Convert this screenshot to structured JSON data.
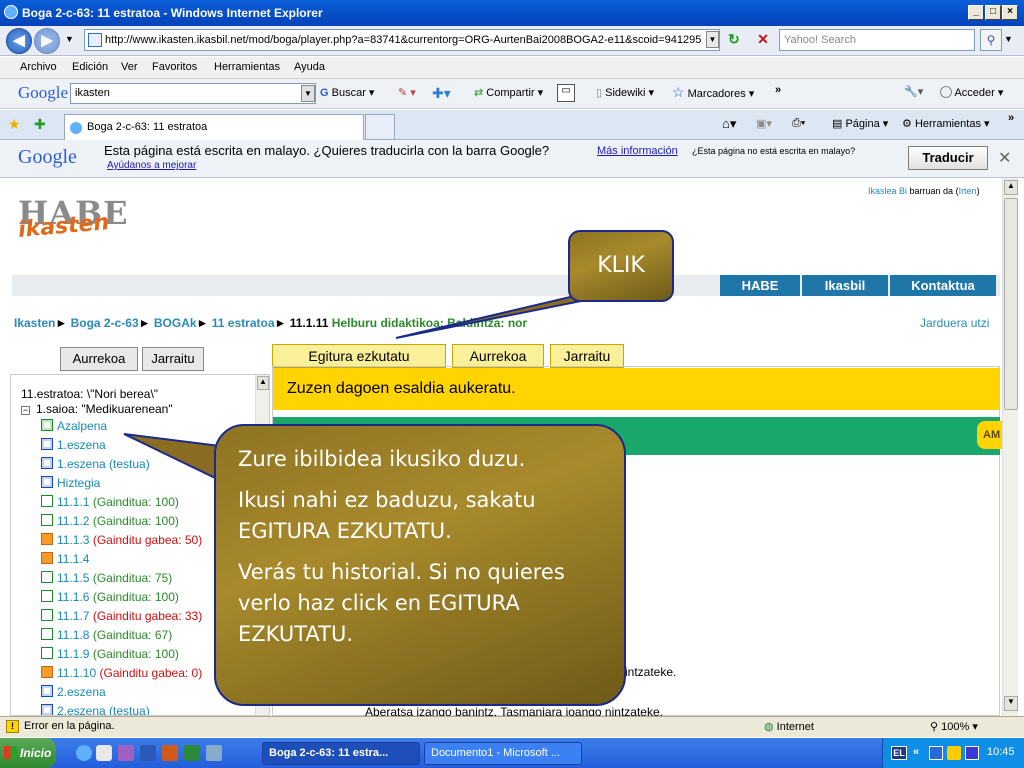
{
  "window": {
    "title": "Boga 2-c-63: 11 estratoa - Windows Internet Explorer"
  },
  "address": {
    "url": "http://www.ikasten.ikasbil.net/mod/boga/player.php?a=83741&currentorg=ORG-AurtenBai2008BOGA2-e11&scoid=941295",
    "search_placeholder": "Yahoo! Search"
  },
  "menu": [
    "Archivo",
    "Edición",
    "Ver",
    "Favoritos",
    "Herramientas",
    "Ayuda"
  ],
  "googlebar": {
    "logo": "Google",
    "query": "ikasten",
    "buscar": "Buscar",
    "compartir": "Compartir",
    "sidewiki": "Sidewiki",
    "marcadores": "Marcadores",
    "acceder": "Acceder"
  },
  "tabbar": {
    "tab_title": "Boga 2-c-63: 11 estratoa",
    "pagina": "Página",
    "herramientas": "Herramientas"
  },
  "translate": {
    "logo": "Google",
    "message": "Esta página está escrita en malayo. ¿Quieres traducirla con la barra Google?",
    "more_info": "Más información",
    "not_malay": "¿Esta página no está escrita en malayo?",
    "help": "Ayúdanos a mejorar",
    "translate_btn": "Traducir"
  },
  "site": {
    "logo_habe": "HABE",
    "logo_ikasten": "ikasten",
    "user_prefix": "Ikaslea Bi",
    "user_mid": " barruan da (",
    "user_logout": "Irten",
    "user_suffix": ")",
    "nav_tabs": [
      "HABE",
      "Ikasbil",
      "Kontaktua"
    ],
    "breadcrumb": {
      "c1": "Ikasten",
      "c2": "Boga 2-c-63",
      "c3": "BOGAk",
      "c4": "11 estratoa",
      "c5": "11.1.11",
      "c6": "Helburu didaktikoa: Baldintza: nor",
      "sep": "►"
    },
    "exit_activity": "Jarduera utzi",
    "left_buttons": [
      "Aurrekoa",
      "Jarraitu"
    ],
    "top_buttons": [
      "Egitura ezkutatu",
      "Aurrekoa",
      "Jarraitu"
    ],
    "instruction": "Zuzen dagoen esaldia aukeratu.",
    "green_tag": "AM",
    "tree_root": "11.estratoa: \\\"Nori berea\\\"",
    "tree_session": "1.saioa: \"Medikuarenean\"",
    "tree": [
      {
        "label": "Azalpena",
        "status": "",
        "status_color": "",
        "icon": "page"
      },
      {
        "label": "1.eszena",
        "status": "",
        "status_color": "",
        "icon": "page-blue"
      },
      {
        "label": "1.eszena (testua)",
        "status": "",
        "status_color": "",
        "icon": "page-blue"
      },
      {
        "label": "Hiztegia",
        "status": "",
        "status_color": "",
        "icon": "page-blue"
      },
      {
        "label": "11.1.1",
        "status": "(Gainditua: 100)",
        "status_color": "#2a8a2a",
        "icon": "check"
      },
      {
        "label": "11.1.2",
        "status": "(Gainditua: 100)",
        "status_color": "#2a8a2a",
        "icon": "check"
      },
      {
        "label": "11.1.3",
        "status": "(Gainditu gabea: 50)",
        "status_color": "#d01010",
        "icon": "orange"
      },
      {
        "label": "11.1.4",
        "status": "",
        "status_color": "",
        "icon": "orange"
      },
      {
        "label": "11.1.5",
        "status": "(Gainditua: 75)",
        "status_color": "#2a8a2a",
        "icon": "check"
      },
      {
        "label": "11.1.6",
        "status": "(Gainditua: 100)",
        "status_color": "#2a8a2a",
        "icon": "check"
      },
      {
        "label": "11.1.7",
        "status": "(Gainditu gabea: 33)",
        "status_color": "#d01010",
        "icon": "check"
      },
      {
        "label": "11.1.8",
        "status": "(Gainditua: 67)",
        "status_color": "#2a8a2a",
        "icon": "check"
      },
      {
        "label": "11.1.9",
        "status": "(Gainditua: 100)",
        "status_color": "#2a8a2a",
        "icon": "check"
      },
      {
        "label": "11.1.10",
        "status": "(Gainditu gabea: 0)",
        "status_color": "#d01010",
        "icon": "orange"
      },
      {
        "label": "2.eszena",
        "status": "",
        "status_color": "",
        "icon": "page-blue"
      },
      {
        "label": "2.eszena (testua)",
        "status": "",
        "status_color": "",
        "icon": "page-blue"
      }
    ],
    "sentence_1": "intzateke.",
    "sentence_2": "Aberatsa izango banintz, Tasmaniara joango nintzateke."
  },
  "callouts": {
    "klik": "KLIK",
    "main_p1": "Zure ibilbidea ikusiko duzu.",
    "main_p2": "Ikusi nahi ez baduzu, sakatu EGITURA EZKUTATU.",
    "main_p3": "Verás tu historial. Si no quieres verlo haz click en EGITURA EZKUTATU."
  },
  "status": {
    "text": "Error en la página.",
    "zone": "Internet",
    "zoom": "100%"
  },
  "taskbar": {
    "start": "Inicio",
    "task1": "Boga 2-c-63: 11 estra...",
    "task2": "Documento1 - Microsoft ...",
    "clock": "10:45",
    "lang": "EL"
  }
}
